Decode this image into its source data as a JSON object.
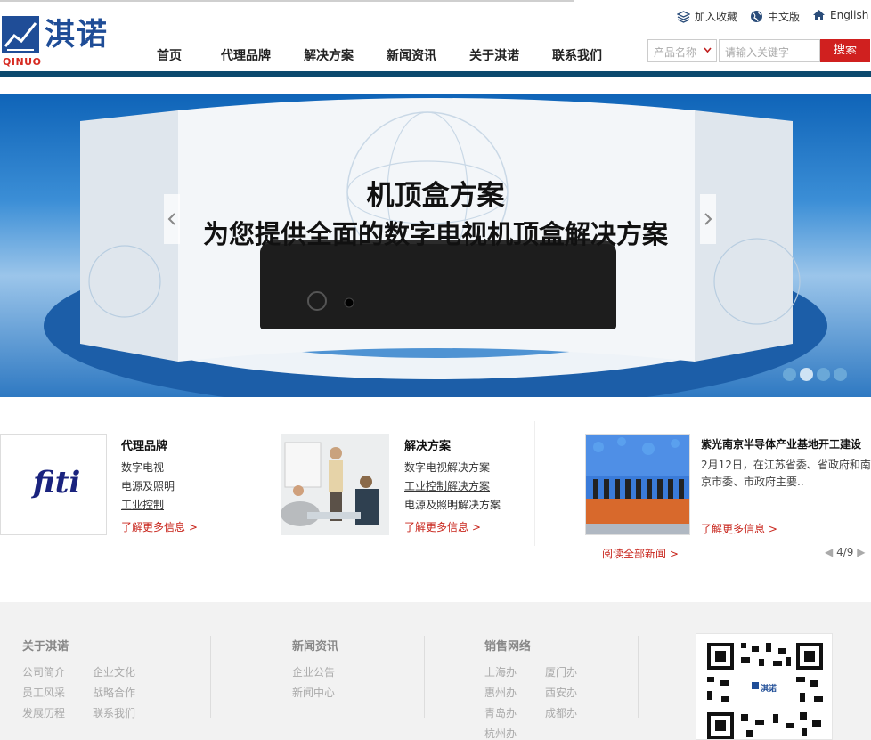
{
  "header": {
    "logo_cn": "淇诺",
    "logo_en": "QINUO",
    "nav": [
      "首页",
      "代理品牌",
      "解决方案",
      "新闻资讯",
      "关于淇诺",
      "联系我们"
    ],
    "toolbar": {
      "favorite": "加入收藏",
      "chinese": "中文版",
      "english": "English"
    },
    "search": {
      "category": "产品名称",
      "placeholder": "请输入关键字",
      "button": "搜索"
    }
  },
  "banner": {
    "title": "机顶盒方案",
    "subtitle": "为您提供全面的数字电视机顶盒解决方案",
    "slides": 4,
    "active_slide": 2
  },
  "features": {
    "brands": {
      "logo_text": "fiti",
      "title": "代理品牌",
      "links": [
        "数字电视",
        "电源及照明",
        "工业控制"
      ],
      "more": "了解更多信息 >"
    },
    "solutions": {
      "title": "解决方案",
      "links": [
        "数字电视解决方案",
        "工业控制解决方案",
        "电源及照明解决方案"
      ],
      "more": "了解更多信息 >"
    },
    "news": {
      "title": "紫光南京半导体产业基地开工建设",
      "summary": "2月12日，在江苏省委、省政府和南京市委、市政府主要..",
      "more": "了解更多信息 >",
      "all_news": "阅读全部新闻 >",
      "pager": "4/9"
    }
  },
  "footer": {
    "about": {
      "title": "关于淇诺",
      "links": [
        "公司简介",
        "企业文化",
        "员工风采",
        "战略合作",
        "发展历程",
        "联系我们"
      ]
    },
    "news": {
      "title": "新闻资讯",
      "links": [
        "企业公告",
        "新闻中心"
      ]
    },
    "sales": {
      "title": "销售网络",
      "links": [
        "上海办",
        "厦门办",
        "惠州办",
        "西安办",
        "青岛办",
        "成都办",
        "杭州办"
      ]
    },
    "qr_label": "淇诺"
  },
  "colors": {
    "brand_blue": "#1f4d97",
    "accent_red": "#d0201f",
    "header_bar": "#0c4a6e"
  }
}
